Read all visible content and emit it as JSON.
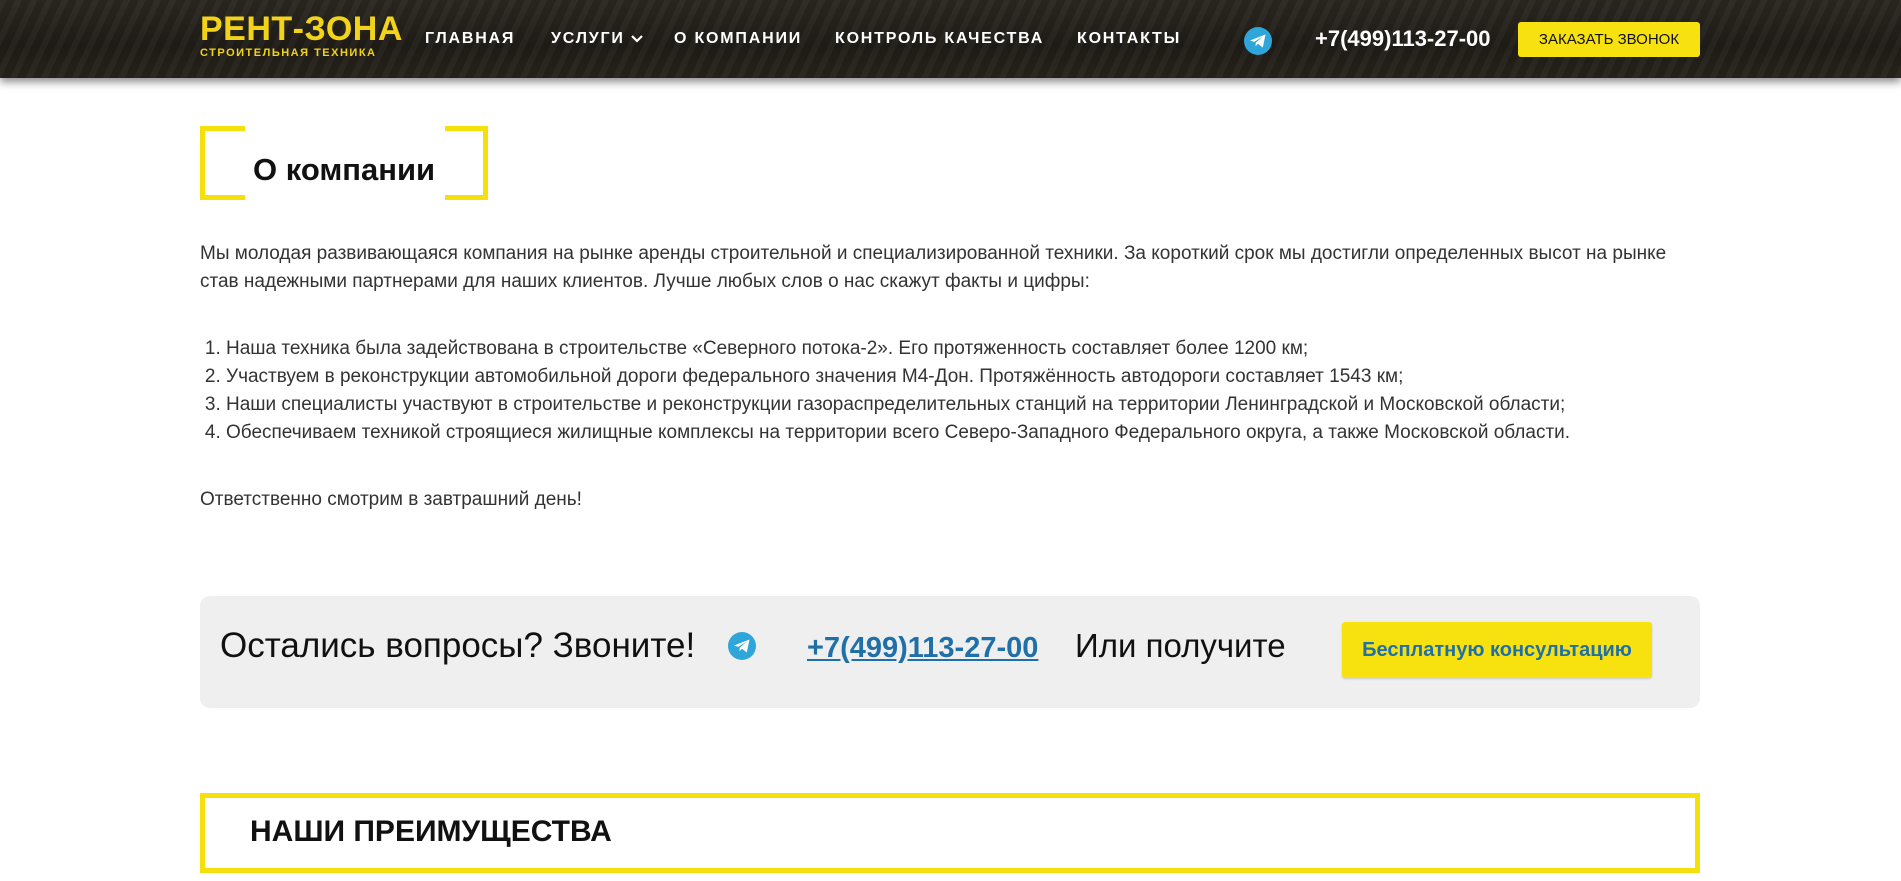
{
  "header": {
    "logo_title": "РЕНТ-ЗОНА",
    "logo_subtitle": "СТРОИТЕЛЬНАЯ ТЕХНИКА",
    "nav": [
      {
        "label": "ГЛАВНАЯ"
      },
      {
        "label": "УСЛУГИ"
      },
      {
        "label": "О КОМПАНИИ"
      },
      {
        "label": "КОНТРОЛЬ КАЧЕСТВА"
      },
      {
        "label": "КОНТАКТЫ"
      }
    ],
    "phone": "+7(499)113-27-00",
    "call_button": "ЗАКАЗАТЬ ЗВОНОК"
  },
  "about": {
    "title": "О компании",
    "intro": "Мы молодая развивающаяся компания на рынке аренды строительной и специализированной техники. За короткий срок мы достигли определенных высот на рынке став надежными партнерами для наших клиентов. Лучше любых слов о нас скажут факты и цифры:",
    "facts": [
      "Наша техника была задействована в строительстве «Северного потока-2». Его протяженность составляет более 1200 км;",
      "Участвуем в реконструкции автомобильной дороги федерального значения М4-Дон. Протяжённость автодороги составляет 1543 км;",
      "Наши специалисты участвуют в строительстве и реконструкции газораспределительных станций на территории Ленинградской и Московской области;",
      "Обеспечиваем техникой строящиеся жилищные комплексы на территории всего Северо-Западного Федерального округа, а также Московской области."
    ],
    "closing": "Ответственно смотрим в завтрашний день!"
  },
  "cta": {
    "question": "Остались вопросы? Звоните!",
    "phone": "+7(499)113-27-00",
    "or_text": "Или получите",
    "button": "Бесплатную консультацию"
  },
  "advantages": {
    "title": "НАШИ ПРЕИМУЩЕСТВА"
  },
  "colors": {
    "accent_yellow": "#f5df0d",
    "link_blue": "#1f6fa8",
    "telegram_blue": "#2ea6da",
    "header_dark": "#221f19"
  },
  "icons": [
    "telegram-icon",
    "chevron-down-icon"
  ]
}
